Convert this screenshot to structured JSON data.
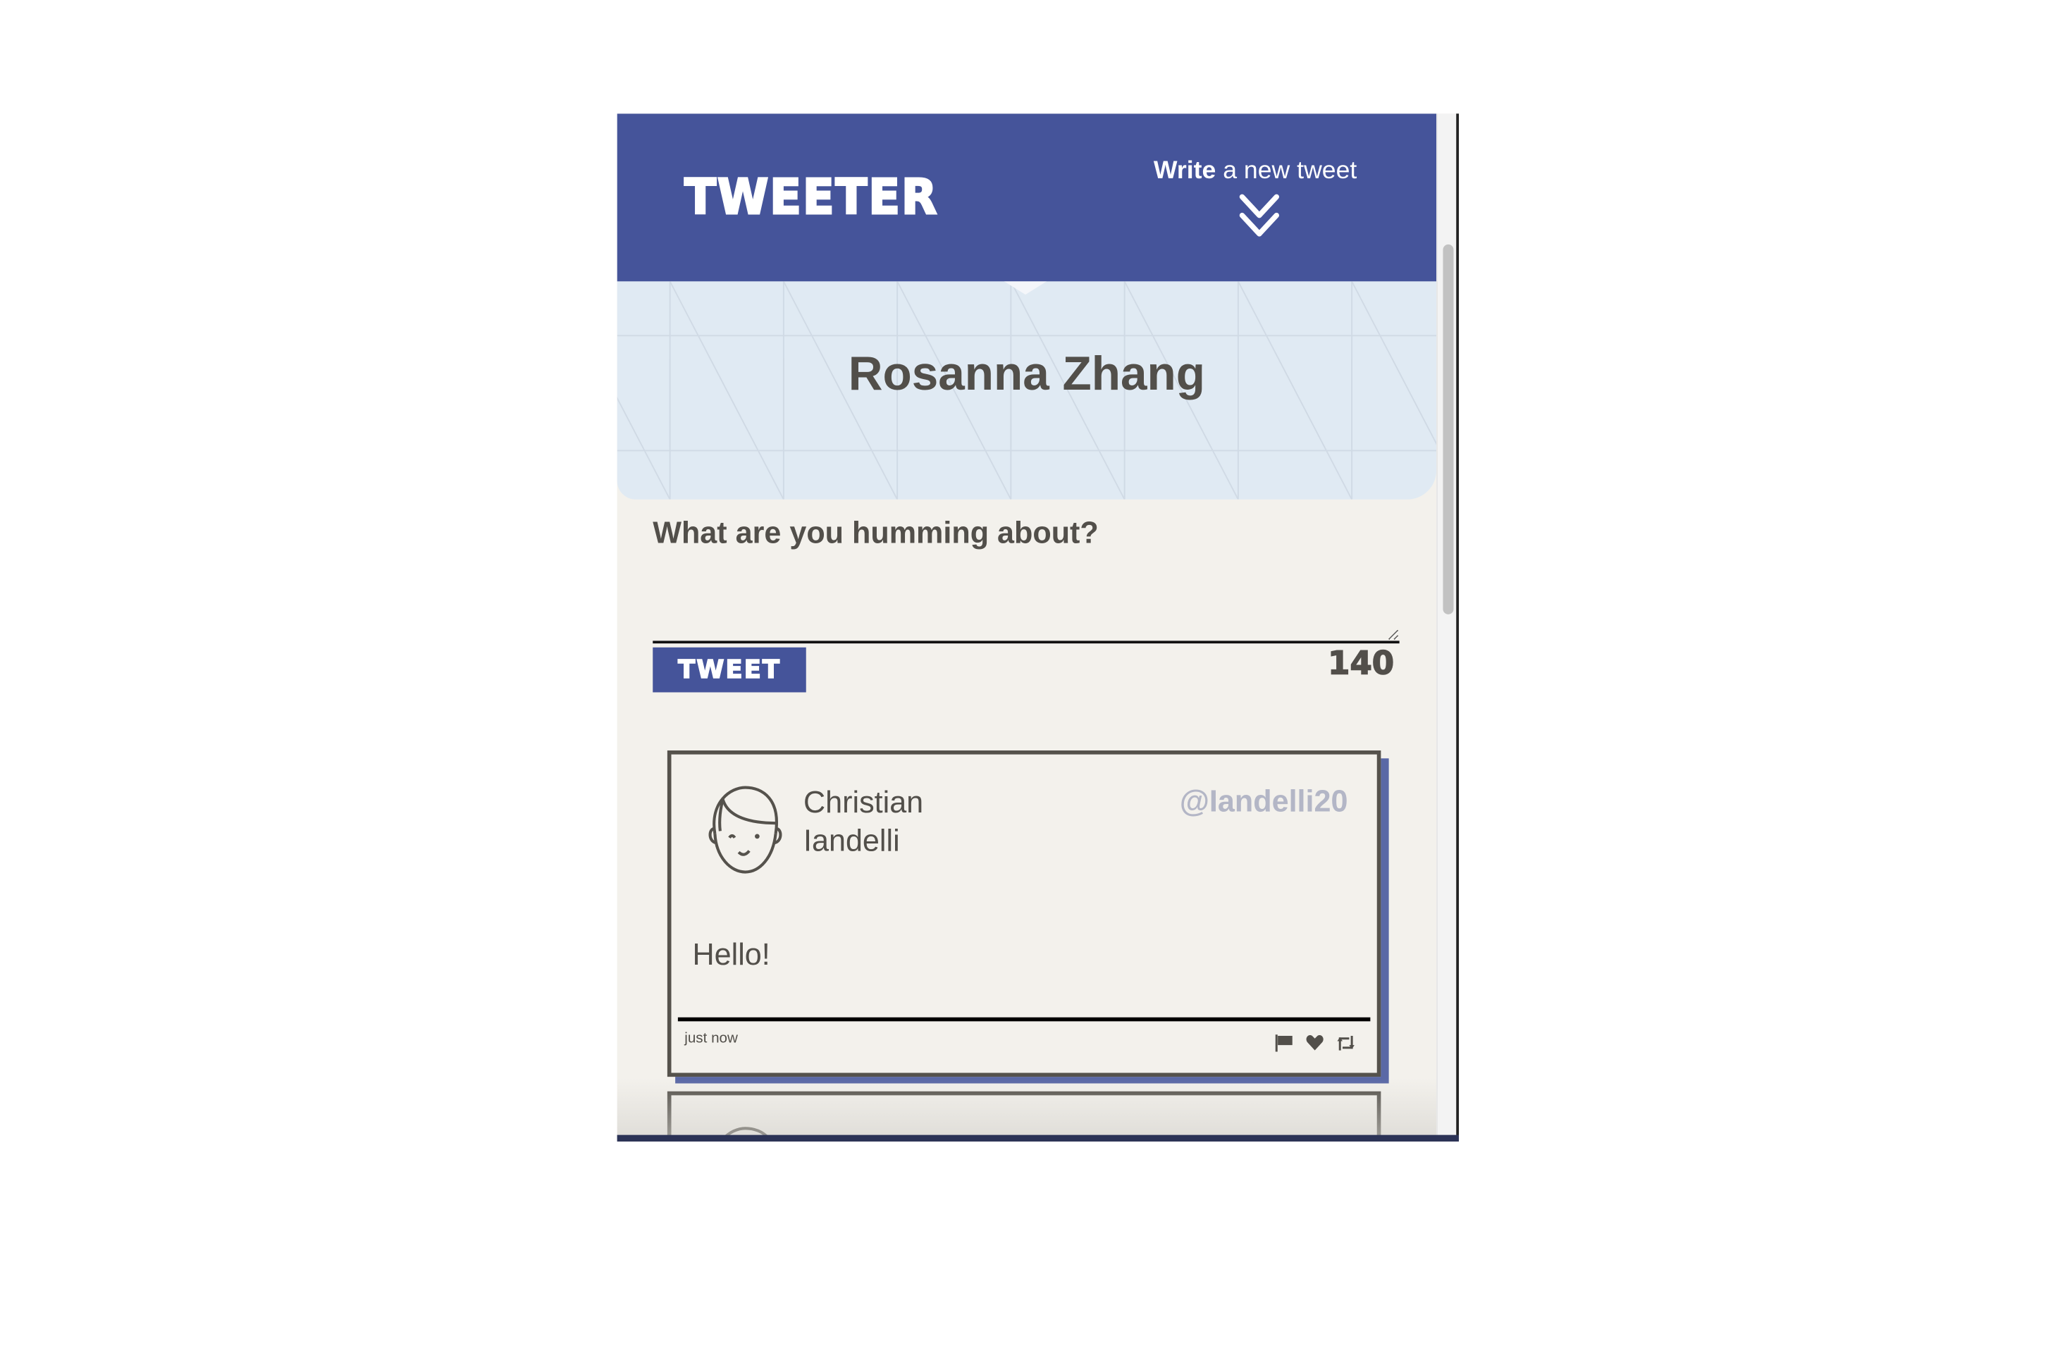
{
  "header": {
    "logo": "TWEETER",
    "write_bold": "Write",
    "write_rest": " a new tweet",
    "accent": "#45549a"
  },
  "profile": {
    "name": "Rosanna Zhang"
  },
  "composer": {
    "prompt": "What are you humming about?",
    "value": "",
    "button": "TWEET",
    "remaining": "140"
  },
  "tweets": [
    {
      "first": "Christian",
      "last": "Iandelli",
      "handle": "@Iandelli20",
      "text": "Hello!",
      "time": "just now"
    }
  ]
}
